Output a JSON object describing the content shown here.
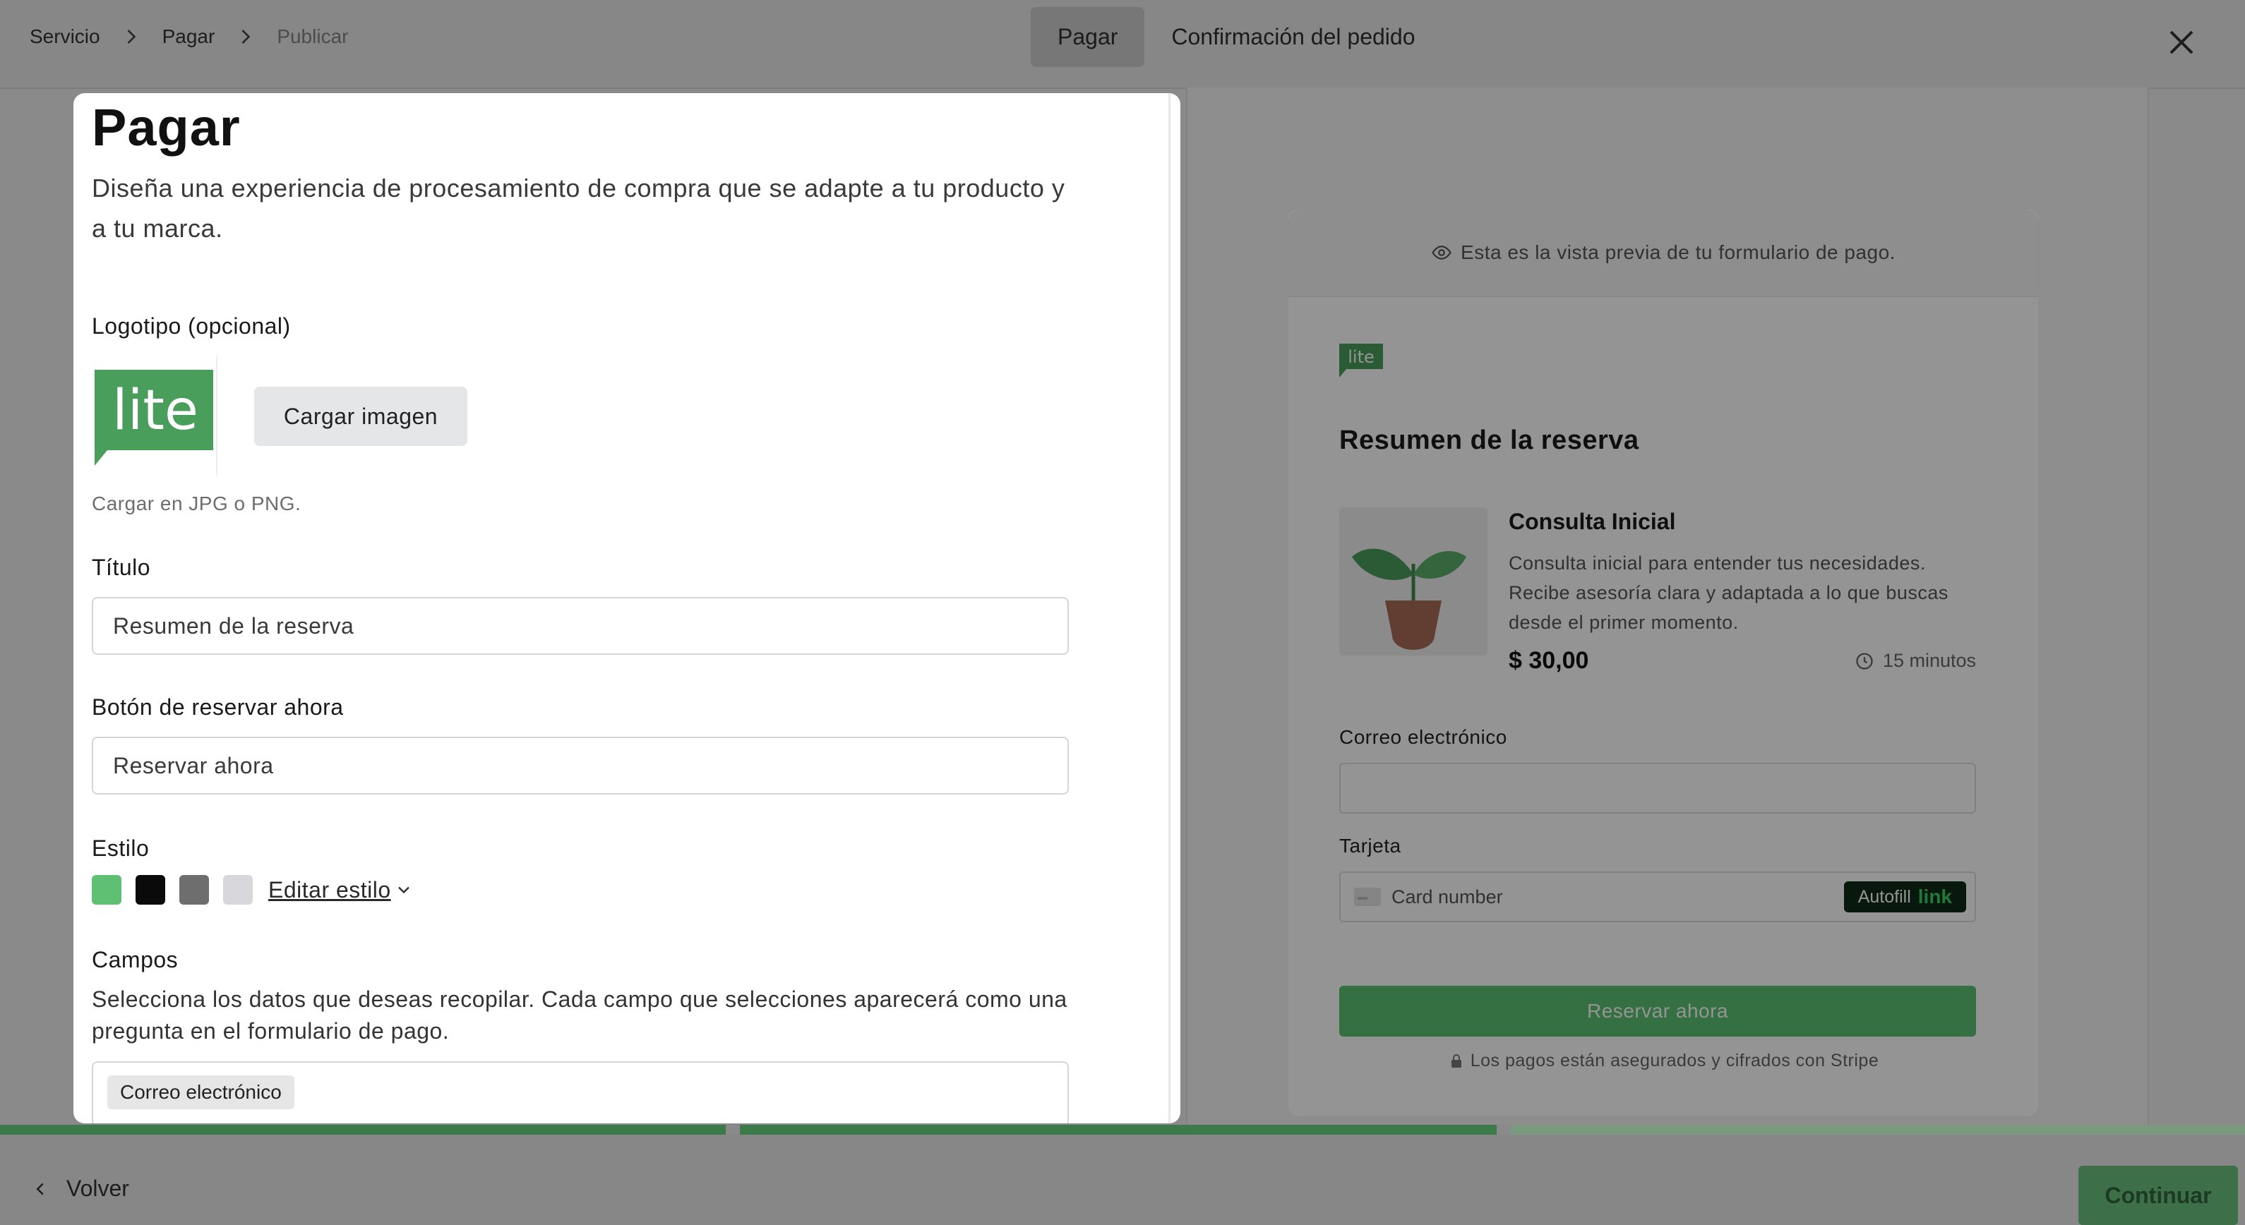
{
  "breadcrumb": {
    "items": [
      "Servicio",
      "Pagar",
      "Publicar"
    ]
  },
  "tabs": [
    {
      "label": "Pagar",
      "active": true
    },
    {
      "label": "Confirmación del pedido",
      "active": false
    }
  ],
  "form": {
    "title": "Pagar",
    "description": "Diseña una experiencia de procesamiento de compra que se adapte a tu producto y a tu marca.",
    "logo_label": "Logotipo (opcional)",
    "logo_text": "lite",
    "upload_button": "Cargar imagen",
    "upload_hint": "Cargar en JPG o PNG.",
    "title_label": "Título",
    "title_value": "Resumen de la reserva",
    "book_label": "Botón de reservar ahora",
    "book_value": "Reservar ahora",
    "style_label": "Estilo",
    "style_colors": [
      "#5fbf73",
      "#0a0a0a",
      "#6e6e6e",
      "#d8d8dc"
    ],
    "edit_style": "Editar estilo",
    "fields_label": "Campos",
    "fields_desc": "Selecciona los datos que deseas recopilar. Cada campo que selecciones aparecerá como una pregunta en el formulario de pago.",
    "field_chip": "Correo electrónico"
  },
  "preview": {
    "banner": "Esta es la vista previa de tu formulario de pago.",
    "logo_text": "lite",
    "heading": "Resumen de la reserva",
    "product_name": "Consulta Inicial",
    "product_desc": "Consulta inicial para entender tus necesidades. Recibe asesoría clara y adaptada a lo que buscas desde el primer momento.",
    "price": "$ 30,00",
    "duration": "15 minutos",
    "email_label": "Correo electrónico",
    "card_label": "Tarjeta",
    "card_placeholder": "Card number",
    "autofill": "Autofill",
    "autofill_link": "link",
    "submit": "Reservar ahora",
    "secure_note": "Los pagos están asegurados y cifrados con Stripe"
  },
  "footer": {
    "back": "Volver",
    "continue": "Continuar"
  },
  "colors": {
    "brand_green": "#5cc273",
    "logo_green": "#4a9e5c"
  }
}
